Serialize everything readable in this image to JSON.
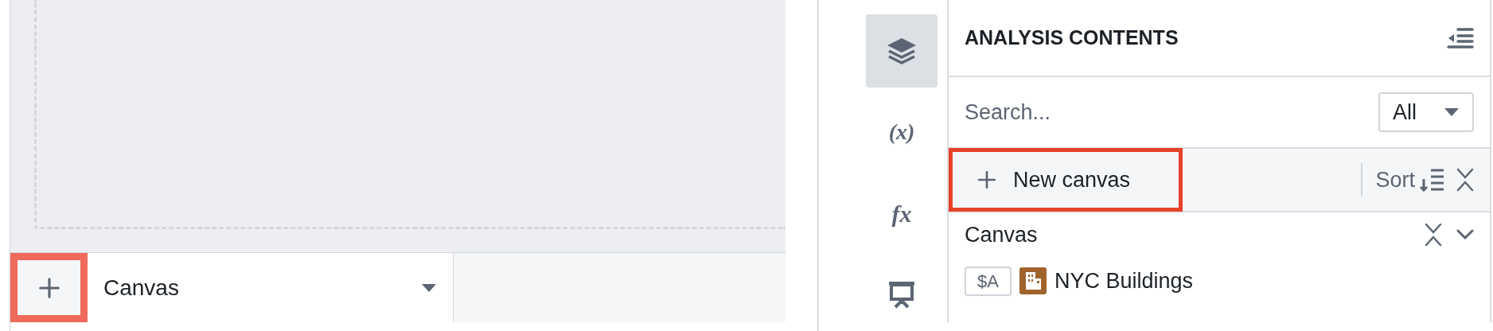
{
  "canvas_tabs": {
    "add_button": {
      "highlighted": true
    },
    "tabs": [
      {
        "label": "Canvas",
        "selected": true
      }
    ]
  },
  "rail": [
    {
      "kind": "layers",
      "selected": true
    },
    {
      "kind": "variables",
      "label": "(x)",
      "selected": false
    },
    {
      "kind": "functions",
      "label": "fx",
      "selected": false
    },
    {
      "kind": "presentation",
      "selected": false
    }
  ],
  "panel": {
    "title": "ANALYSIS CONTENTS",
    "search": {
      "placeholder": "Search..."
    },
    "filter": {
      "value": "All"
    },
    "toolbar": {
      "new_button": {
        "label": "New canvas",
        "highlighted": true
      },
      "sort_label": "Sort"
    },
    "sections": [
      {
        "title": "Canvas",
        "expanded": true,
        "items": [
          {
            "tag": "$A",
            "name": "NYC Buildings",
            "color": "#a0632c"
          }
        ]
      }
    ]
  }
}
